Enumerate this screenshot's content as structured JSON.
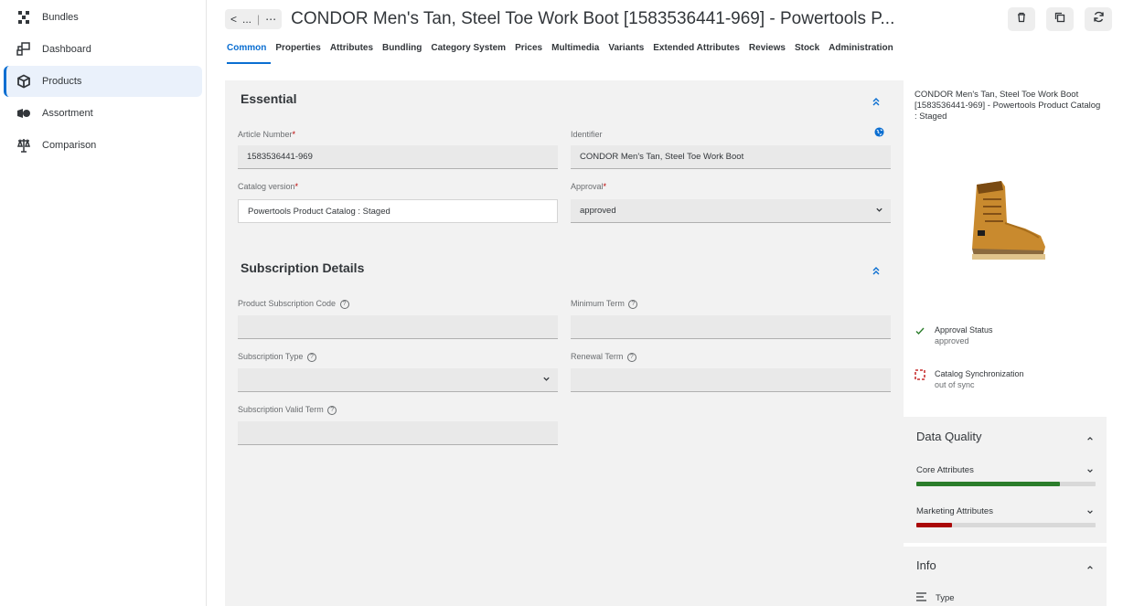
{
  "sidebar": {
    "items": [
      {
        "label": "Bundles",
        "icon": "bundles-icon"
      },
      {
        "label": "Dashboard",
        "icon": "dashboard-icon"
      },
      {
        "label": "Products",
        "icon": "products-icon",
        "active": true
      },
      {
        "label": "Assortment",
        "icon": "assortment-icon"
      },
      {
        "label": "Comparison",
        "icon": "comparison-icon"
      }
    ]
  },
  "header": {
    "back_label": "<",
    "ellipsis": "...",
    "more": "⋯",
    "title": "CONDOR Men's Tan, Steel Toe Work Boot [1583536441-969] - Powertools P..."
  },
  "tabs": [
    "Common",
    "Properties",
    "Attributes",
    "Bundling",
    "Category System",
    "Prices",
    "Multimedia",
    "Variants",
    "Extended Attributes",
    "Reviews",
    "Stock",
    "Administration"
  ],
  "essential": {
    "title": "Essential",
    "article_number_label": "Article Number",
    "article_number": "1583536441-969",
    "identifier_label": "Identifier",
    "identifier": "CONDOR Men's Tan, Steel Toe Work Boot",
    "catalog_version_label": "Catalog version",
    "catalog_version": "Powertools Product Catalog : Staged",
    "approval_label": "Approval",
    "approval": "approved",
    "required_mark": "*"
  },
  "subscription": {
    "title": "Subscription Details",
    "code_label": "Product Subscription Code",
    "min_term_label": "Minimum Term",
    "type_label": "Subscription Type",
    "renewal_label": "Renewal Term",
    "valid_term_label": "Subscription Valid Term",
    "help_glyph": "?"
  },
  "right_panel": {
    "title": "CONDOR Men's Tan, Steel Toe Work Boot [1583536441-969] - Powertools Product Catalog : Staged",
    "approval_status_label": "Approval Status",
    "approval_status_value": "approved",
    "sync_label": "Catalog Synchronization",
    "sync_value": "out of sync"
  },
  "data_quality": {
    "title": "Data Quality",
    "core_label": "Core Attributes",
    "core_fraction": 0.8,
    "core_color": "#2b7d2b",
    "marketing_label": "Marketing Attributes",
    "marketing_fraction": 0.2,
    "marketing_color": "#aa0808"
  },
  "info": {
    "title": "Info",
    "type_label": "Type"
  },
  "colors": {
    "accent": "#0a6ed1",
    "required": "#bb0000"
  }
}
